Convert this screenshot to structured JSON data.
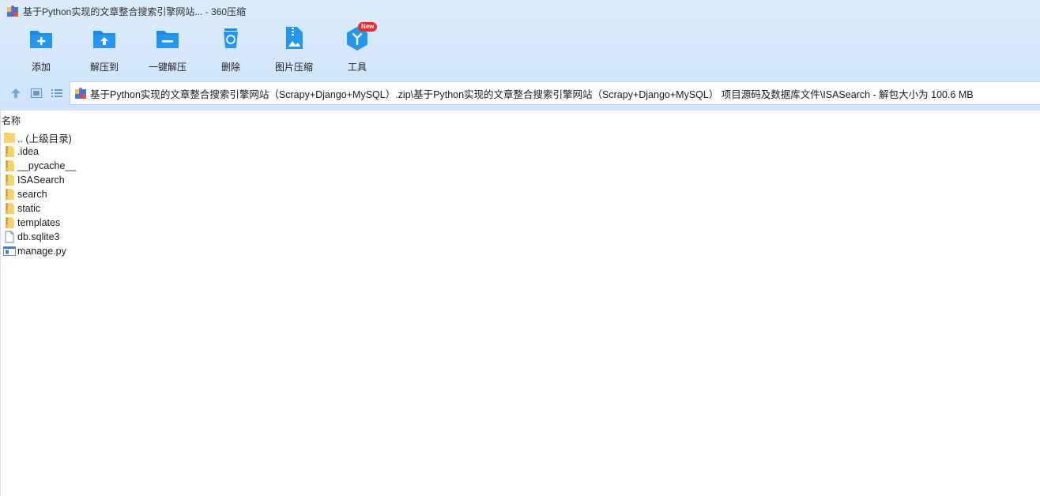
{
  "window": {
    "title": "基于Python实现的文章整合搜索引擎网站... - 360压缩"
  },
  "toolbar": {
    "items": [
      {
        "label": "添加",
        "icon": "add-folder-icon"
      },
      {
        "label": "解压到",
        "icon": "extract-to-icon"
      },
      {
        "label": "一键解压",
        "icon": "one-click-extract-icon"
      },
      {
        "label": "删除",
        "icon": "delete-recycle-icon"
      },
      {
        "label": "图片压缩",
        "icon": "image-compress-icon"
      },
      {
        "label": "工具",
        "icon": "tools-cube-icon",
        "badge": "New"
      }
    ]
  },
  "nav": {
    "path": "基于Python实现的文章整合搜索引擎网站（Scrapy+Django+MySQL）.zip\\基于Python实现的文章整合搜索引擎网站（Scrapy+Django+MySQL） 项目源码及数据库文件\\ISASearch - 解包大小为 100.6 MB"
  },
  "list": {
    "header": "名称",
    "files": [
      {
        "name": ".. (上级目录)",
        "type": "parent-folder"
      },
      {
        "name": ".idea",
        "type": "folder"
      },
      {
        "name": "__pycache__",
        "type": "folder"
      },
      {
        "name": "ISASearch",
        "type": "folder"
      },
      {
        "name": "search",
        "type": "folder"
      },
      {
        "name": "static",
        "type": "folder"
      },
      {
        "name": "templates",
        "type": "folder"
      },
      {
        "name": "db.sqlite3",
        "type": "file"
      },
      {
        "name": "manage.py",
        "type": "python-file"
      }
    ]
  },
  "colors": {
    "accent": "#1e88e5",
    "toolbar_bg": "#d6e9fb",
    "folder": "#f6c54a",
    "badge": "#ee2b2b"
  }
}
